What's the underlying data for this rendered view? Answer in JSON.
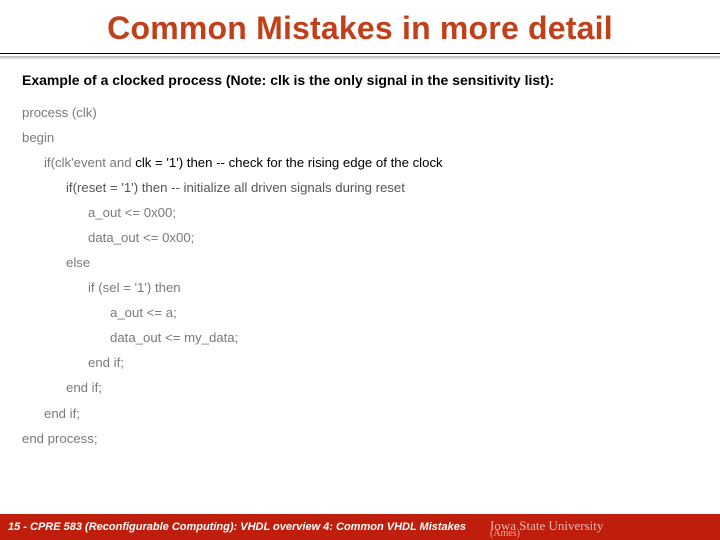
{
  "title": "Common Mistakes in more detail",
  "code": {
    "heading": "Example of a clocked process (Note: clk is the only signal in the sensitivity list):",
    "l01": "process (clk)",
    "l02": "begin",
    "l03a": "if(clk'event and ",
    "l03b": "clk = '1') then",
    "l03c": "  -- check for the rising edge of the clock",
    "l04": "if(reset = '1') then -- initialize all driven signals during reset",
    "l05": "a_out <= 0x00;",
    "l06": "data_out <= 0x00;",
    "l07": "else",
    "l08": "if (sel = '1') then",
    "l09": "a_out <= a;",
    "l10": "data_out <= my_data;",
    "l11": "end if;",
    "l12": "end if;",
    "l13": "end if;",
    "l14": "end process;"
  },
  "footer": {
    "left": "15 - CPRE 583 (Reconfigurable Computing): VHDL overview 4: Common VHDL Mistakes",
    "right_top": "Iowa State University",
    "right_bottom": "(Ames)"
  }
}
